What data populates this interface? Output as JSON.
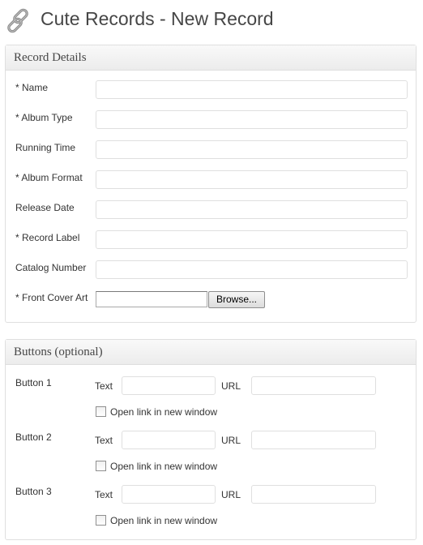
{
  "header": {
    "title": "Cute Records - New Record",
    "icon": "link-icon"
  },
  "record_details": {
    "title": "Record Details",
    "fields": [
      {
        "label": "* Name",
        "value": ""
      },
      {
        "label": "* Album Type",
        "value": ""
      },
      {
        "label": "Running Time",
        "value": ""
      },
      {
        "label": "* Album Format",
        "value": ""
      },
      {
        "label": "Release Date",
        "value": ""
      },
      {
        "label": "* Record Label",
        "value": ""
      },
      {
        "label": "Catalog Number",
        "value": ""
      }
    ],
    "cover": {
      "label": "* Front Cover Art",
      "browse_label": "Browse..."
    }
  },
  "buttons_panel": {
    "title": "Buttons (optional)",
    "text_label": "Text",
    "url_label": "URL",
    "newwin_label": "Open link in new window",
    "buttons": [
      {
        "label": "Button 1",
        "text": "",
        "url": "",
        "new_window": false
      },
      {
        "label": "Button 2",
        "text": "",
        "url": "",
        "new_window": false
      },
      {
        "label": "Button 3",
        "text": "",
        "url": "",
        "new_window": false
      }
    ]
  }
}
